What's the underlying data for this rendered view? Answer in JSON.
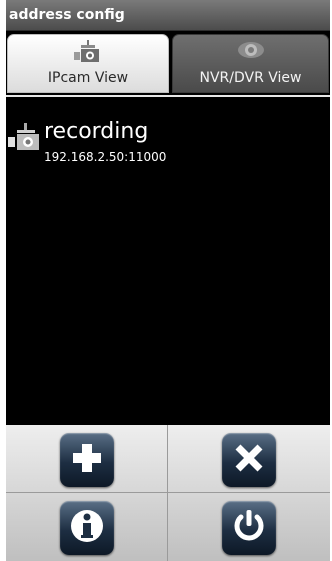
{
  "window": {
    "title": "address config"
  },
  "tabs": [
    {
      "label": "IPcam View",
      "icon": "ip-camera-icon",
      "active": true
    },
    {
      "label": "NVR/DVR View",
      "icon": "eye-icon",
      "active": false
    }
  ],
  "devices": [
    {
      "name": "recording",
      "address": "192.168.2.50:11000",
      "icon": "ip-camera-icon"
    }
  ],
  "toolbar": {
    "add": {
      "icon": "plus-icon"
    },
    "delete": {
      "icon": "close-icon"
    },
    "info": {
      "icon": "info-icon"
    },
    "power": {
      "icon": "power-icon"
    }
  },
  "colors": {
    "title_bar": "#5f5f5f",
    "button": "#1d2e42",
    "background": "#000000"
  }
}
